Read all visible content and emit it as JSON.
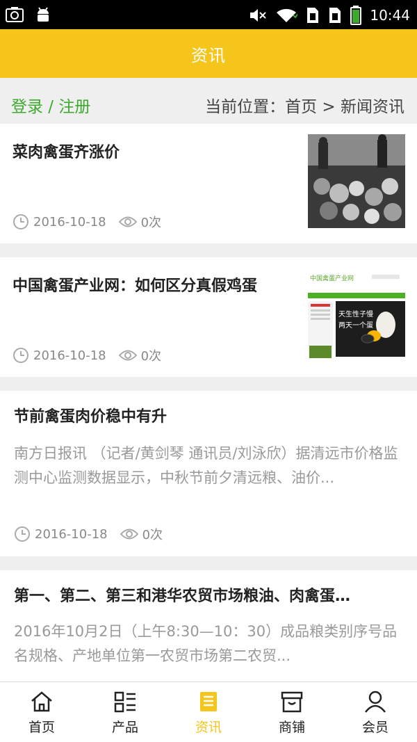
{
  "status_bar": {
    "time": "10:44",
    "left_icons": [
      "camera-icon",
      "android-icon"
    ],
    "right_icons": [
      "mute-icon",
      "wifi-icon",
      "sim1-icon",
      "sim2-icon",
      "battery-icon"
    ]
  },
  "header": {
    "title": "资讯"
  },
  "breadcrumb": {
    "login_label": "登录 / 注册",
    "location_text": "当前位置：首页 > 新闻资讯"
  },
  "articles": [
    {
      "title": "菜肉禽蛋齐涨价",
      "date": "2016-10-18",
      "views": "0次",
      "thumbnail": "market-photo"
    },
    {
      "title": "中国禽蛋产业网：如何区分真假鸡蛋",
      "date": "2016-10-18",
      "views": "0次",
      "thumbnail": "website-screenshot",
      "thumb_text": {
        "site_name": "中国禽蛋产业网",
        "slogan_line1": "天生性子慢",
        "slogan_line2": "两天一个蛋"
      }
    },
    {
      "title": "节前禽蛋肉价稳中有升",
      "summary": "南方日报讯 （记者/黄剑琴 通讯员/刘泳欣）据清远市价格监测中心监测数据显示，中秋节前夕清远粮、油价...",
      "date": "2016-10-18",
      "views": "0次"
    },
    {
      "title": "第一、第二、第三和港华农贸市场粮油、肉禽蛋…",
      "summary": "2016年10月2日（上午8:30—10：30）成品粮类别序号品名规格、产地单位第一农贸市场第二农贸..."
    }
  ],
  "bottom_nav": {
    "tabs": [
      {
        "label": "首页",
        "icon": "home-icon",
        "active": false
      },
      {
        "label": "产品",
        "icon": "product-grid-icon",
        "active": false
      },
      {
        "label": "资讯",
        "icon": "news-icon",
        "active": true
      },
      {
        "label": "商铺",
        "icon": "shop-icon",
        "active": false
      },
      {
        "label": "会员",
        "icon": "user-icon",
        "active": false
      }
    ]
  },
  "colors": {
    "accent": "#f5c51c",
    "login_green": "#3daa2e",
    "background": "#efefef"
  }
}
